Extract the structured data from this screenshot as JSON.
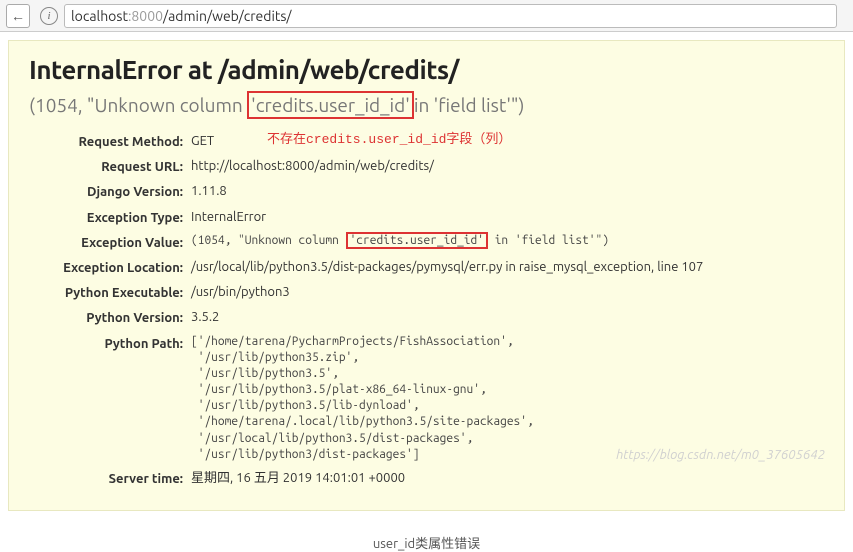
{
  "browser": {
    "url_host": "localhost",
    "url_port": ":8000",
    "url_path": "/admin/web/credits/"
  },
  "error": {
    "title": "InternalError at /admin/web/credits/",
    "subtitle_prefix": "(1054, \"Unknown column",
    "subtitle_boxed": "'credits.user_id_id'",
    "subtitle_suffix": "in 'field list'\")",
    "annotation": "不存在credits.user_id_id字段（列）"
  },
  "details": {
    "request_method": {
      "label": "Request Method:",
      "value": "GET"
    },
    "request_url": {
      "label": "Request URL:",
      "value": "http://localhost:8000/admin/web/credits/"
    },
    "django_version": {
      "label": "Django Version:",
      "value": "1.11.8"
    },
    "exception_type": {
      "label": "Exception Type:",
      "value": "InternalError"
    },
    "exception_value": {
      "label": "Exception Value:",
      "prefix": "(1054, \"Unknown column ",
      "boxed": "'credits.user_id_id'",
      "suffix": " in 'field list'\")"
    },
    "exception_location": {
      "label": "Exception Location:",
      "value": "/usr/local/lib/python3.5/dist-packages/pymysql/err.py in raise_mysql_exception, line 107"
    },
    "python_executable": {
      "label": "Python Executable:",
      "value": "/usr/bin/python3"
    },
    "python_version": {
      "label": "Python Version:",
      "value": "3.5.2"
    },
    "python_path": {
      "label": "Python Path:",
      "value": "['/home/tarena/PycharmProjects/FishAssociation',\n '/usr/lib/python35.zip',\n '/usr/lib/python3.5',\n '/usr/lib/python3.5/plat-x86_64-linux-gnu',\n '/usr/lib/python3.5/lib-dynload',\n '/home/tarena/.local/lib/python3.5/site-packages',\n '/usr/local/lib/python3.5/dist-packages',\n '/usr/lib/python3/dist-packages']"
    },
    "server_time": {
      "label": "Server time:",
      "value": "星期四, 16 五月 2019 14:01:01 +0000"
    }
  },
  "watermark": "https://blog.csdn.net/m0_37605642",
  "caption": "user_id类属性错误"
}
